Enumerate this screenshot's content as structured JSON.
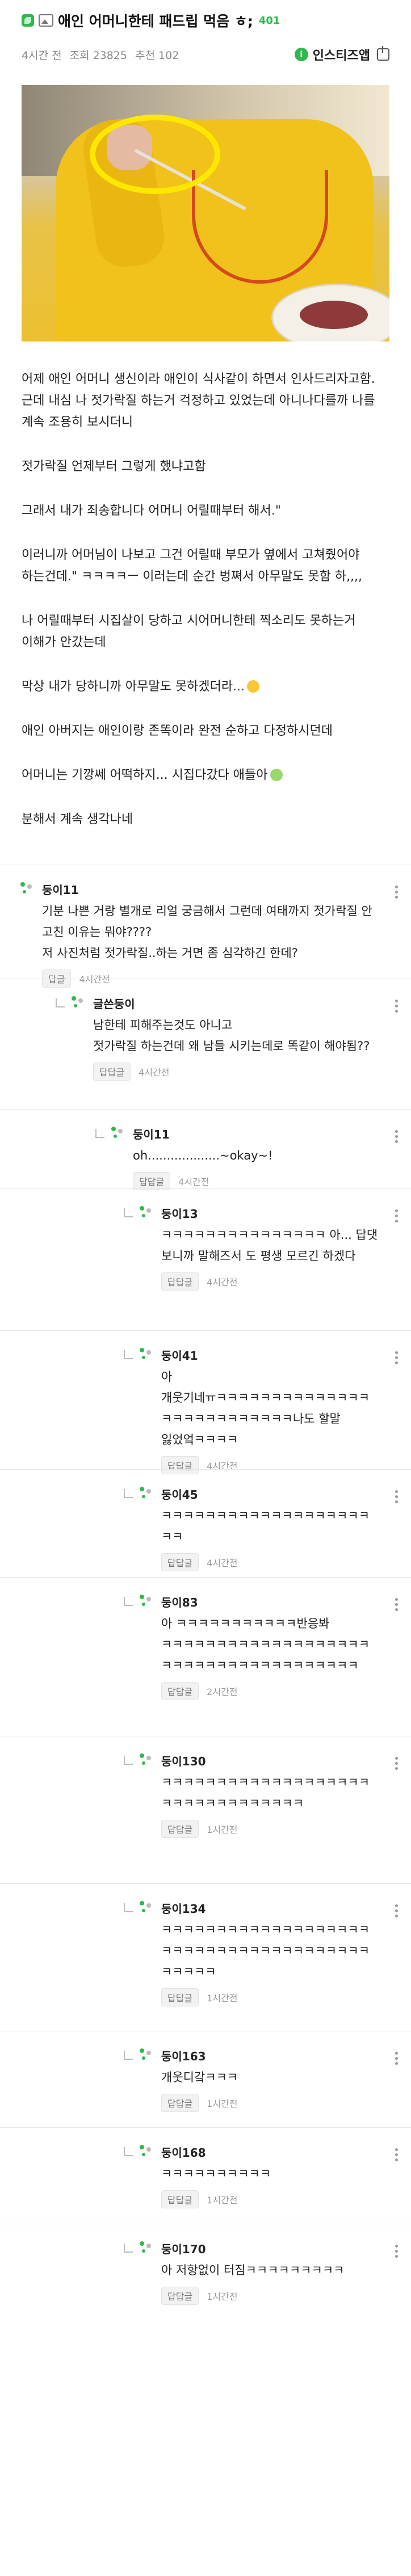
{
  "header": {
    "title": "애인 어머니한테 패드립 먹음 ㅎ;",
    "count": "401",
    "time": "4시간 전",
    "views": "조회 23825",
    "recommend": "추천 102",
    "board": "인스티즈앱"
  },
  "article": {
    "paragraphs": [
      "어제 애인 어머니 생신이라 애인이 식사같이 하면서 인사드리자고함. 근데 내심 나 젓가락질 하는거 걱정하고 있었는데 아니나다를까 나를 계속 조용히 보시더니",
      "젓가락질 언제부터 그렇게 했냐고함",
      "그래서 내가 죄송합니다 어머니 어릴때부터 해서.\"",
      "이러니까 어머님이 나보고 그건 어릴때 부모가 옆에서 고쳐줬어야 하는건데.\"  ㅋㅋㅋㅋㅡ 이러는데 순간 벙쪄서 아무말도 못함 하,,,,",
      "나 어릴때부터 시집살이 당하고 시어머니한테 찍소리도 못하는거 이해가 안갔는데",
      "막상 내가 당하니까 아무말도 못하겠더라...",
      "애인 아버지는 애인이랑 존똑이라 완전 순하고 다정하시던데",
      "어머니는 기깡쎄 어떡하지... 시집다갔다 애들아",
      "분해서 계속 생각나네"
    ]
  },
  "comments": [
    {
      "name": "둥이11",
      "text": "기분 나쁜 거랑 별개로 리얼 궁금해서 그런데 여태까지 젓가락질 안 고친 이유는 뭐야????\n저 사진처럼 젓가락질..하는 거면 좀 심각하긴 한데?",
      "reply": "답글",
      "time": "4시간전"
    },
    {
      "name": "글쓴둥이",
      "text": "남한테 피해주는것도 아니고\n젓가락질 하는건데 왜 남들 시키는데로 똑같이 해야됨??",
      "reply": "답답글",
      "time": "4시간전"
    },
    {
      "name": "둥이11",
      "text": "oh...................~okay~!",
      "reply": "답답글",
      "time": "4시간전"
    },
    {
      "name": "둥이13",
      "text": "ㅋㅋㅋㅋㅋㅋㅋㅋㅋㅋㅋㅋㅋㅋㅋ 아... 답댓 보니까 말해즈서 도 평생 모르긴 하겠다",
      "reply": "답답글",
      "time": "4시간전"
    },
    {
      "name": "둥이41",
      "text": "아 개웃기네ㅠㅋㅋㅋㅋㅋㅋㅋㅋㅋㅋㅋㅋㅋㅋㅋㅋㅋㅋㅋㅋㅋㅋㅋㅋㅋㅋ나도 할말 잃었엌ㅋㅋㅋㅋ",
      "reply": "답답글",
      "time": "4시간전"
    },
    {
      "name": "둥이45",
      "text": "ㅋㅋㅋㅋㅋㅋㅋㅋㅋㅋㅋㅋㅋㅋㅋㅋㅋㅋㅋㅋㅋ",
      "reply": "답답글",
      "time": "4시간전"
    },
    {
      "name": "둥이83",
      "text": "아 ㅋㅋㅋㅋㅋㅋㅋㅋㅋㅋㅋ반응봐 ㅋㅋㅋㅋㅋㅋㅋㅋㅋㅋㅋㅋㅋㅋㅋㅋㅋㅋㅋㅋㅋㅋㅋㅋㅋㅋㅋㅋㅋㅋㅋㅋㅋㅋㅋㅋㅋ",
      "reply": "답답글",
      "time": "2시간전"
    },
    {
      "name": "둥이130",
      "text": "ㅋㅋㅋㅋㅋㅋㅋㅋㅋㅋㅋㅋㅋㅋㅋㅋㅋㅋㅋㅋㅋㅋㅋㅋㅋㅋㅋㅋㅋㅋㅋㅋ",
      "reply": "답답글",
      "time": "1시간전"
    },
    {
      "name": "둥이134",
      "text": "ㅋㅋㅋㅋㅋㅋㅋㅋㅋㅋㅋㅋㅋㅋㅋㅋㅋㅋㅋㅋㅋㅋㅋㅋㅋㅋㅋㅋㅋㅋㅋㅋㅋㅋㅋㅋㅋㅋㅋㅋㅋㅋㅋ",
      "reply": "답답글",
      "time": "1시간전"
    },
    {
      "name": "둥이163",
      "text": "개웃디갘ㅋㅋㅋ",
      "reply": "답답글",
      "time": "1시간전"
    },
    {
      "name": "둥이168",
      "text": "ㅋㅋㅋㅋㅋㅋㅋㅋㅋㅋ",
      "reply": "답답글",
      "time": "1시간전"
    },
    {
      "name": "둥이170",
      "text": "아 저항없이 터짐ㅋㅋㅋㅋㅋㅋㅋㅋㅋ",
      "reply": "답답글",
      "time": "1시간전"
    }
  ],
  "colors": {
    "accent": "#2fb84d",
    "highlight": "#ffe800"
  }
}
